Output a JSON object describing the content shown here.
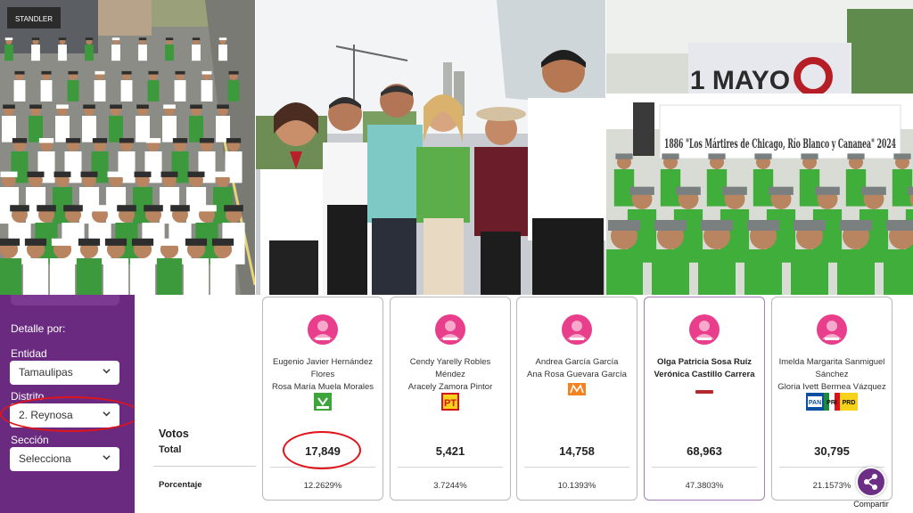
{
  "photos": {
    "left": {
      "shop_sign": "STANDLER"
    },
    "right": {
      "banner_top": "1 MAYO",
      "banner_bottom": "1886 \"Los Mártires de Chicago, Río Blanco y Cananea\" 2024"
    }
  },
  "sidebar": {
    "title": "Detalle por:",
    "entidad": {
      "label": "Entidad",
      "value": "Tamaulipas"
    },
    "distrito": {
      "label": "Distrito",
      "value": "2. Reynosa"
    },
    "seccion": {
      "label": "Sección",
      "value": "Selecciona"
    }
  },
  "results": {
    "votos_label": "Votos",
    "total_label": "Total",
    "porcentaje_label": "Porcentaje",
    "candidates": [
      {
        "propietario": "Eugenio Javier Hernández Flores",
        "suplente": "Rosa María Muela Morales",
        "party": "VERDE",
        "votes": "17,849",
        "percent": "12.2629%"
      },
      {
        "propietario": "Cendy Yarelly Robles Méndez",
        "suplente": "Aracely Zamora Pintor",
        "party": "PT",
        "votes": "5,421",
        "percent": "3.7244%"
      },
      {
        "propietario": "Andrea García García",
        "suplente": "Ana Rosa Guevara García",
        "party": "MC",
        "votes": "14,758",
        "percent": "10.1393%"
      },
      {
        "propietario": "Olga Patricia Sosa Ruíz",
        "suplente": "Verónica Castillo Carrera",
        "party": "morena",
        "votes": "68,963",
        "percent": "47.3803%"
      },
      {
        "propietario": "Imelda Margarita Sanmiguel Sánchez",
        "suplente": "Gloria Ivett Bermea Vázquez",
        "party": "PAN PRI PRD",
        "votes": "30,795",
        "percent": "21.1573%"
      }
    ]
  },
  "share": {
    "label": "Compartir"
  },
  "colors": {
    "sidebar": "#6a2a80",
    "avatar": "#e83e8c",
    "highlight": "#e0141b",
    "verde": "#3ea53a",
    "pt": "#d4141b",
    "mc": "#f58220",
    "morena": "#b5282e",
    "pan": "#0b4fa1"
  }
}
